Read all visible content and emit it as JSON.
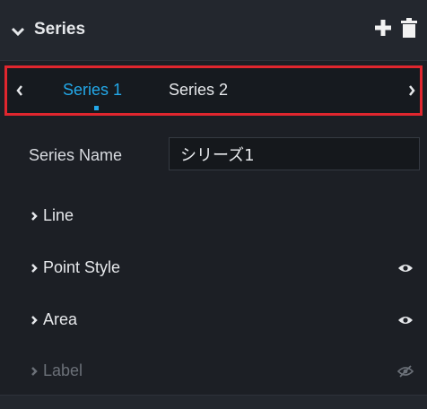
{
  "header": {
    "title": "Series"
  },
  "tabs": [
    {
      "label": "Series 1",
      "active": true
    },
    {
      "label": "Series 2",
      "active": false
    }
  ],
  "series_name": {
    "label": "Series Name",
    "value": "シリーズ1"
  },
  "sections": [
    {
      "label": "Line",
      "visibility_icon": null,
      "enabled": true
    },
    {
      "label": "Point Style",
      "visibility_icon": "eye-icon",
      "enabled": true
    },
    {
      "label": "Area",
      "visibility_icon": "eye-icon",
      "enabled": true
    },
    {
      "label": "Label",
      "visibility_icon": "eye-off-icon",
      "enabled": false
    }
  ],
  "colors": {
    "accent": "#23a8e8",
    "highlight_border": "#e0262e",
    "panel_bg": "#1c1f25",
    "header_bg": "#23272e",
    "disabled_text": "#6b7078"
  }
}
